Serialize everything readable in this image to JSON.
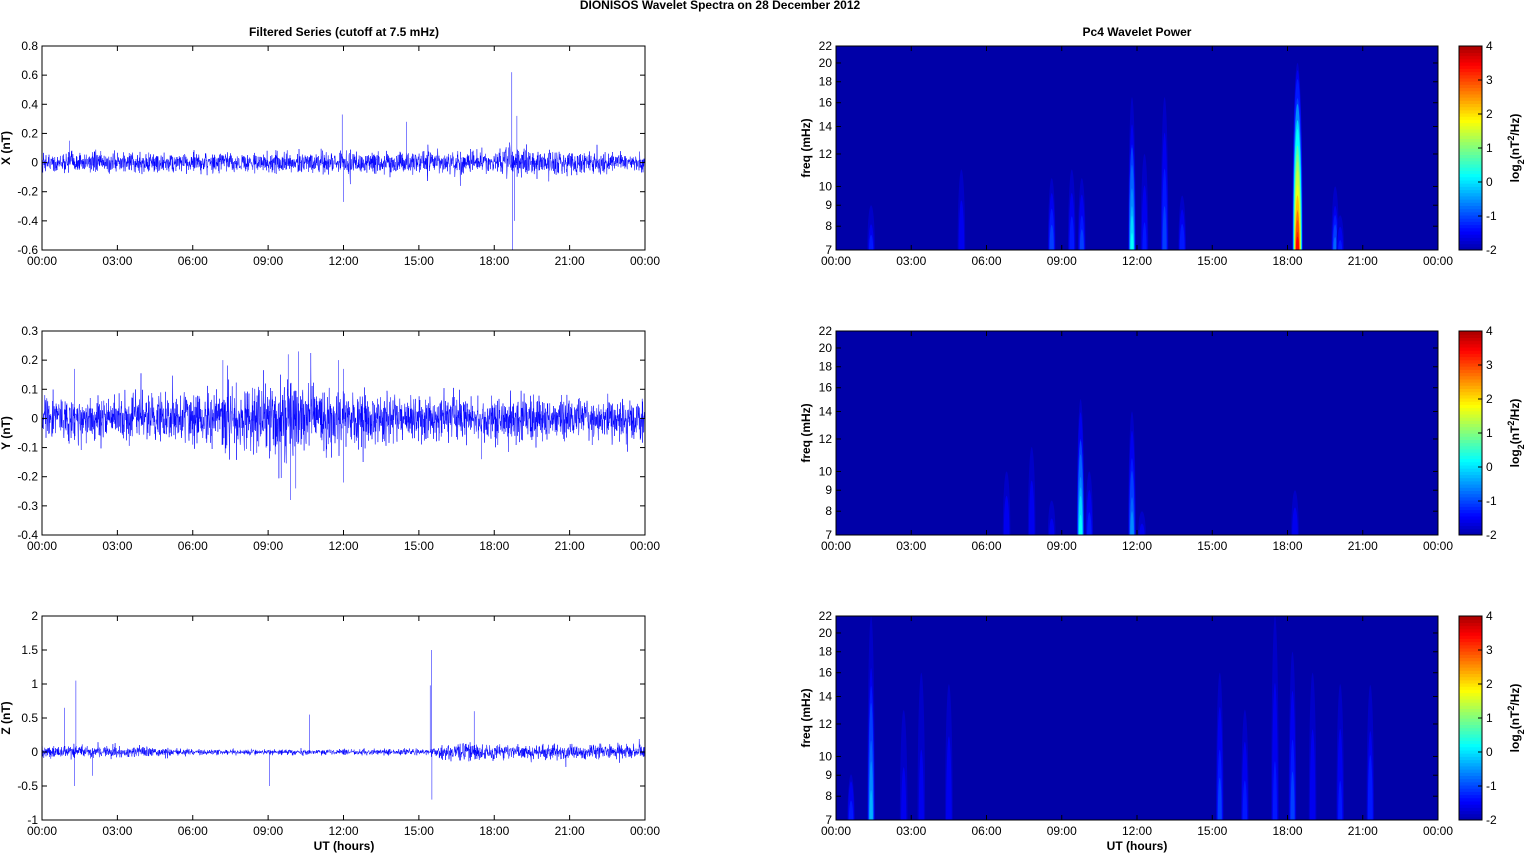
{
  "chart_data": {
    "title": "DIONISOS Wavelet Spectra on 28 December  2012",
    "xlabel": "UT (hours)",
    "time_ticks": [
      "00:00",
      "03:00",
      "06:00",
      "09:00",
      "12:00",
      "15:00",
      "18:00",
      "21:00",
      "00:00"
    ],
    "xlim_hours": [
      0,
      24
    ],
    "series_panels": {
      "type": "line",
      "title": "Filtered Series (cutoff at 7.5 mHz)",
      "color": "#0000ff",
      "panels": [
        {
          "ylabel": "X (nT)",
          "ylim": [
            -0.6,
            0.8
          ],
          "yticks": [
            -0.6,
            -0.4,
            -0.2,
            0,
            0.2,
            0.4,
            0.6,
            0.8
          ],
          "noise_envelope": [
            [
              0,
              0.06
            ],
            [
              6,
              0.06
            ],
            [
              9,
              0.06
            ],
            [
              12,
              0.07
            ],
            [
              18,
              0.06
            ],
            [
              18.5,
              0.09
            ],
            [
              19.5,
              0.08
            ],
            [
              24,
              0.05
            ]
          ],
          "spikes": [
            [
              1.1,
              0.15
            ],
            [
              11.95,
              0.33
            ],
            [
              12.0,
              -0.27
            ],
            [
              14.5,
              0.28
            ],
            [
              18.7,
              0.62
            ],
            [
              18.72,
              -0.6
            ],
            [
              18.9,
              0.32
            ],
            [
              18.8,
              -0.4
            ]
          ]
        },
        {
          "ylabel": "Y (nT)",
          "ylim": [
            -0.4,
            0.3
          ],
          "yticks": [
            -0.4,
            -0.3,
            -0.2,
            -0.1,
            0,
            0.1,
            0.2,
            0.3
          ],
          "noise_envelope": [
            [
              0,
              0.06
            ],
            [
              1,
              0.07
            ],
            [
              5,
              0.07
            ],
            [
              7,
              0.09
            ],
            [
              9,
              0.1
            ],
            [
              10,
              0.13
            ],
            [
              11,
              0.09
            ],
            [
              12,
              0.09
            ],
            [
              14,
              0.07
            ],
            [
              24,
              0.06
            ]
          ],
          "spikes": [
            [
              1.3,
              0.17
            ],
            [
              7.2,
              0.2
            ],
            [
              9.8,
              0.22
            ],
            [
              10.2,
              0.23
            ],
            [
              9.9,
              -0.28
            ],
            [
              10.1,
              -0.24
            ],
            [
              12.0,
              0.17
            ],
            [
              12.0,
              -0.22
            ],
            [
              11.8,
              0.2
            ],
            [
              17.5,
              -0.14
            ]
          ]
        },
        {
          "ylabel": "Z (nT)",
          "ylim": [
            -1,
            2
          ],
          "yticks": [
            -1,
            -0.5,
            0,
            0.5,
            1,
            1.5,
            2
          ],
          "noise_envelope": [
            [
              0,
              0.08
            ],
            [
              4,
              0.07
            ],
            [
              6,
              0.04
            ],
            [
              9,
              0.035
            ],
            [
              15.4,
              0.04
            ],
            [
              15.6,
              0.09
            ],
            [
              17,
              0.13
            ],
            [
              19,
              0.1
            ],
            [
              24,
              0.09
            ]
          ],
          "spikes": [
            [
              0.9,
              0.65
            ],
            [
              1.35,
              1.05
            ],
            [
              1.3,
              -0.5
            ],
            [
              10.65,
              0.55
            ],
            [
              9.05,
              -0.5
            ],
            [
              15.5,
              1.5
            ],
            [
              15.52,
              -0.7
            ],
            [
              15.45,
              0.98
            ],
            [
              17.2,
              0.6
            ],
            [
              2.0,
              -0.35
            ]
          ]
        }
      ]
    },
    "spectra_panels": {
      "type": "heatmap",
      "title": "Pc4 Wavelet Power",
      "ylabel": "freq (mHz)",
      "yscale": "log",
      "ylim": [
        7,
        22
      ],
      "yticks": [
        7,
        8,
        9,
        10,
        12,
        14,
        16,
        18,
        20,
        22
      ],
      "colorbar": {
        "label_parts": [
          "log",
          "2",
          "(nT",
          "2",
          "/Hz)"
        ],
        "range": [
          -2,
          4
        ],
        "ticks": [
          -2,
          -1,
          0,
          1,
          2,
          3,
          4
        ],
        "colormap": "jet"
      },
      "background_power": -2,
      "panels": [
        {
          "bursts": [
            [
              1.4,
              9,
              -1.3
            ],
            [
              5.0,
              11,
              -1.4
            ],
            [
              8.6,
              10.5,
              -0.9
            ],
            [
              9.4,
              11,
              -1.2
            ],
            [
              9.8,
              10.5,
              -1.0
            ],
            [
              11.8,
              16.5,
              0.2
            ],
            [
              12.3,
              12,
              -1.3
            ],
            [
              13.1,
              16.5,
              -1.0
            ],
            [
              13.8,
              9.5,
              -1.1
            ],
            [
              18.4,
              20,
              3.6
            ],
            [
              19.9,
              10,
              -0.8
            ],
            [
              20.1,
              8.5,
              -1.3
            ]
          ]
        },
        {
          "bursts": [
            [
              6.8,
              10,
              -1.4
            ],
            [
              7.8,
              11.5,
              -1.4
            ],
            [
              8.6,
              8.5,
              -1.5
            ],
            [
              9.75,
              15,
              0.4
            ],
            [
              10.1,
              10,
              -1.2
            ],
            [
              11.8,
              14,
              -0.5
            ],
            [
              12.2,
              8,
              -1.5
            ],
            [
              18.3,
              9,
              -1.4
            ]
          ]
        },
        {
          "bursts": [
            [
              0.6,
              9.5,
              -1.2
            ],
            [
              1.4,
              22,
              -0.3
            ],
            [
              2.7,
              13,
              -1.5
            ],
            [
              3.4,
              16,
              -1.5
            ],
            [
              4.5,
              15,
              -1.4
            ],
            [
              15.3,
              16,
              -1.0
            ],
            [
              16.3,
              13,
              -1.2
            ],
            [
              17.5,
              22,
              -1.3
            ],
            [
              18.2,
              18,
              -1.0
            ],
            [
              19.0,
              16,
              -1.4
            ],
            [
              20.1,
              15,
              -1.3
            ],
            [
              21.3,
              15,
              -1.1
            ]
          ]
        }
      ]
    }
  }
}
